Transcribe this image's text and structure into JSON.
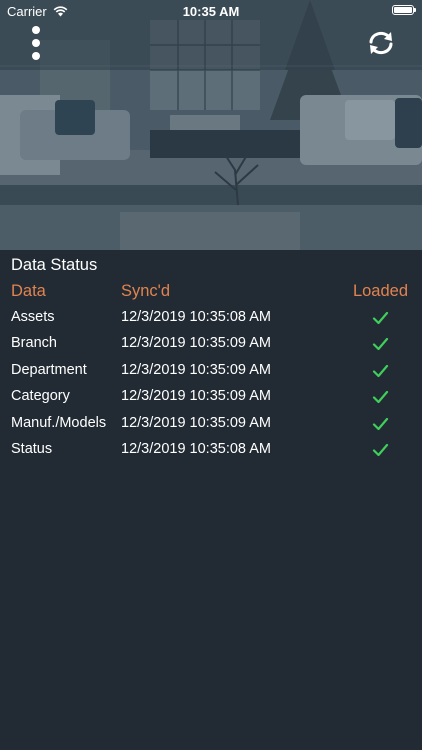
{
  "status_bar": {
    "carrier": "Carrier",
    "time": "10:35 AM"
  },
  "nav": {
    "menu_icon": "more-vertical-icon",
    "sync_icon": "refresh-icon"
  },
  "data_status": {
    "title": "Data Status",
    "columns": {
      "data": "Data",
      "synced": "Sync'd",
      "loaded": "Loaded"
    },
    "rows": [
      {
        "name": "Assets",
        "synced": "12/3/2019 10:35:08 AM",
        "loaded": true
      },
      {
        "name": "Branch",
        "synced": "12/3/2019 10:35:09 AM",
        "loaded": true
      },
      {
        "name": "Department",
        "synced": "12/3/2019 10:35:09 AM",
        "loaded": true
      },
      {
        "name": "Category",
        "synced": "12/3/2019 10:35:09 AM",
        "loaded": true
      },
      {
        "name": "Manuf./Models",
        "synced": "12/3/2019 10:35:09 AM",
        "loaded": true
      },
      {
        "name": "Status",
        "synced": "12/3/2019 10:35:08 AM",
        "loaded": true
      }
    ]
  },
  "colors": {
    "background": "#222b34",
    "accent_header": "#e1834f",
    "check_green": "#3fcf5a",
    "text": "#ffffff"
  }
}
